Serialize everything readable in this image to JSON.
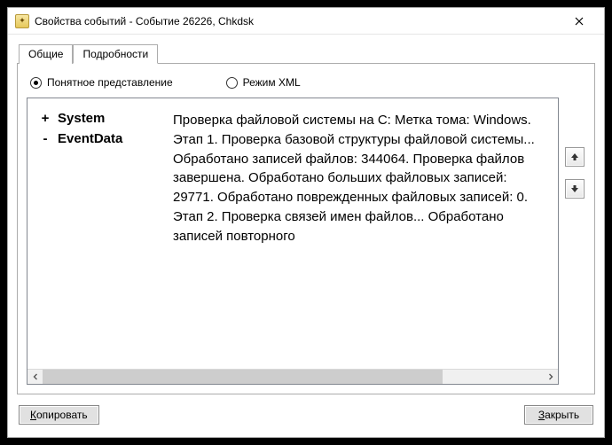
{
  "window": {
    "title": "Свойства событий - Событие 26226, Chkdsk"
  },
  "tabs": {
    "general": "Общие",
    "details": "Подробности"
  },
  "radios": {
    "friendly": "Понятное представление",
    "xml": "Режим XML"
  },
  "tree": {
    "system": {
      "toggle": "+",
      "label": "System"
    },
    "eventdata": {
      "toggle": "-",
      "label": "EventData"
    }
  },
  "details_text": "Проверка файловой системы на C: Метка тома: Windows. Этап 1. Проверка базовой структуры файловой системы... Обработано записей файлов: 344064. Проверка файлов завершена. Обработано больших файловых записей: 29771. Обработано поврежденных файловых записей: 0. Этап 2. Проверка связей имен файлов... Обработано записей повторного",
  "buttons": {
    "copy": "Копировать",
    "close": "Закрыть"
  }
}
